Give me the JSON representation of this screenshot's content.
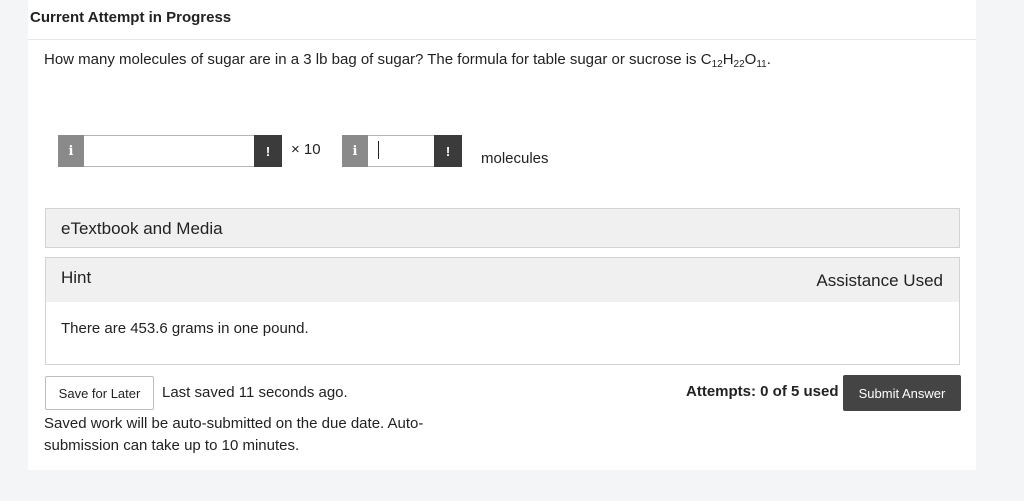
{
  "header": {
    "title": "Current Attempt in Progress"
  },
  "question": {
    "prefix": "How many molecules of sugar are in a 3 lb bag of sugar? The formula for table sugar or sucrose is ",
    "formula": {
      "c": "C",
      "c_sub": "12",
      "h": "H",
      "h_sub": "22",
      "o": "O",
      "o_sub": "11",
      "end": "."
    }
  },
  "answer": {
    "info_icon": "i",
    "warn_icon": "!",
    "mantissa_value": "",
    "times_ten": "× 10",
    "exponent_value": "",
    "unit": "molecules"
  },
  "panels": {
    "etextbook_label": "eTextbook and Media",
    "hint_label": "Hint",
    "assistance_label": "Assistance Used",
    "hint_text": "There are 453.6 grams in one pound."
  },
  "footer": {
    "save_label": "Save for Later",
    "saved_status": "Last saved 11 seconds ago.",
    "auto_submit_note": "Saved work will be auto-submitted on the due date. Auto-submission can take up to 10 minutes.",
    "attempts": "Attempts: 0 of 5 used",
    "submit_label": "Submit Answer"
  }
}
